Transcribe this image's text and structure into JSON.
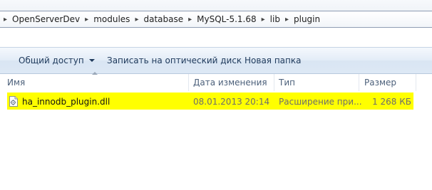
{
  "breadcrumb": {
    "items": [
      "OpenServerDev",
      "modules",
      "database",
      "MySQL-5.1.68",
      "lib",
      "plugin"
    ],
    "separator": "▸"
  },
  "toolbar": {
    "share_label": "Общий доступ",
    "burn_label": "Записать на оптический диск",
    "new_folder_label": "Новая папка"
  },
  "columns": {
    "name": "Имя",
    "date": "Дата изменения",
    "type": "Тип",
    "size": "Размер"
  },
  "files": [
    {
      "name": "ha_innodb_plugin.dll",
      "date": "08.01.2013 20:14",
      "type": "Расширение при...",
      "size": "1 268 КБ",
      "icon": "dll-file-icon"
    }
  ],
  "colors": {
    "highlight": "#ffff00",
    "toolbar_text": "#1e395b",
    "header_text": "#4c607a"
  }
}
